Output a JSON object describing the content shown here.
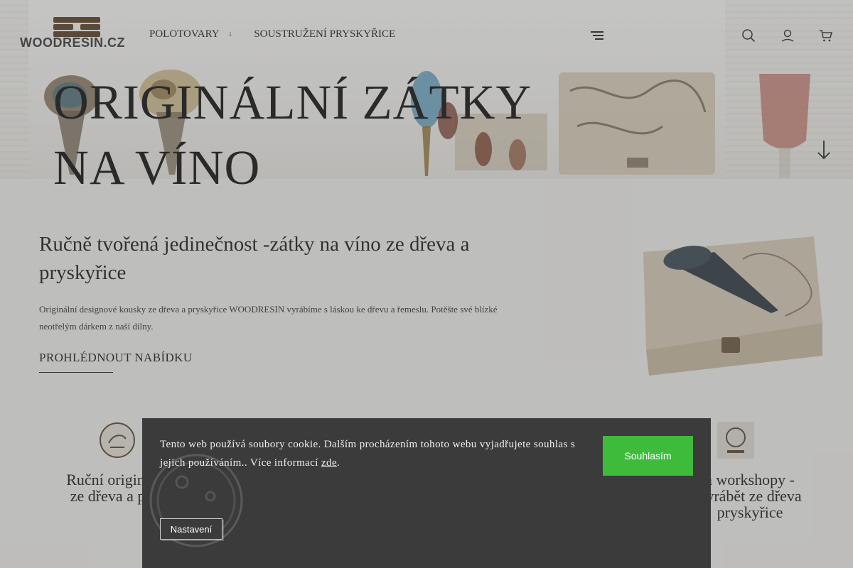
{
  "header": {
    "logo_text": "WOODRESIN.CZ",
    "nav": [
      {
        "label": "POLOTOVARY",
        "has_dropdown": true
      },
      {
        "label": "SOUSTRUŽENÍ PRYSKYŘICE",
        "has_dropdown": false
      }
    ],
    "icons": [
      "menu-icon",
      "search-icon",
      "user-icon",
      "cart-icon"
    ]
  },
  "hero": {
    "title_line1": "ORIGINÁLNÍ ZÁTKY",
    "title_line2": "NA VÍNO"
  },
  "intro": {
    "heading": "Ručně tvořená jedinečnost -zátky na víno ze dřeva a pryskyřice",
    "text": "Originální designové kousky ze dřeva a pryskyřice WOODRESIN vyrábíme s láskou ke dřevu a řemeslu. Potěšte své blízké neotřelým dárkem z naší dílny.",
    "cta": "PROHLÉDNOUT NABÍDKU"
  },
  "features": [
    {
      "title_line1": "Ruční originální",
      "title_line2": "ze dřeva a prys"
    },
    {
      "title_line1": "a workshopy -",
      "title_line2": "vyrábět ze dřeva",
      "title_line3": "pryskyřice"
    }
  ],
  "cookie": {
    "text_line1": "Tento web používá soubory cookie. Dalším procházením tohoto webu vyjadřujete",
    "text_line2_before": "souhlas s jejich používáním.. Více informací ",
    "link": "zde",
    "text_line2_after": ".",
    "accept": "Souhlasím",
    "settings": "Nastavení"
  },
  "colors": {
    "accept_button": "#3fbb3c",
    "cookie_bar": "#3b3b3b",
    "overlay": "rgba(90,90,90,0.34)"
  }
}
